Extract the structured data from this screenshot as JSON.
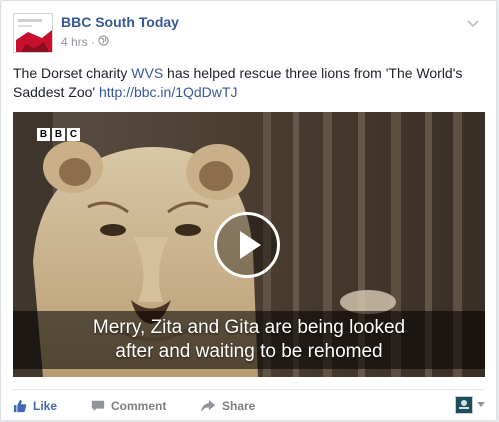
{
  "post": {
    "page_name": "BBC South Today",
    "time": "4 hrs",
    "separator": "·",
    "text_before": "The Dorset charity ",
    "charity_link": "WVS",
    "text_after": " has helped rescue three lions from 'The World's Saddest Zoo' ",
    "url": "http://bbc.in/1QdDwTJ"
  },
  "video": {
    "logo_letters": [
      "B",
      "B",
      "C"
    ],
    "caption_line1": "Merry, Zita and Gita are being looked",
    "caption_line2": "after and waiting to be rehomed"
  },
  "actions": {
    "like": "Like",
    "comment": "Comment",
    "share": "Share"
  },
  "colors": {
    "link": "#365899",
    "like_accent": "#4267b2",
    "muted": "#90949c"
  },
  "icons": [
    "globe-icon",
    "chevron-down-icon",
    "play-icon",
    "thumbs-up-icon",
    "comment-icon",
    "share-icon",
    "caret-down-icon"
  ]
}
